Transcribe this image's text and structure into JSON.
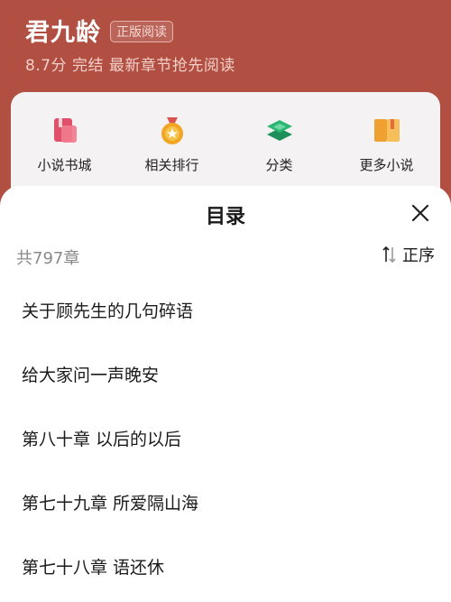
{
  "book": {
    "title": "君九龄",
    "badge": "正版阅读",
    "subtitle": "8.7分 完结 最新章节抢先阅读"
  },
  "menu": {
    "items": [
      {
        "label": "小说书城",
        "icon": "book-store-icon",
        "color": "#e0506a"
      },
      {
        "label": "相关排行",
        "icon": "medal-icon",
        "color": "#f0a623"
      },
      {
        "label": "分类",
        "icon": "layers-icon",
        "color": "#2bb673"
      },
      {
        "label": "更多小说",
        "icon": "open-book-icon",
        "color": "#f0a030"
      }
    ]
  },
  "toc": {
    "title": "目录",
    "count": "共797章",
    "order_label": "正序",
    "chapters": [
      "关于顾先生的几句碎语",
      "给大家问一声晚安",
      "第八十章 以后的以后",
      "第七十九章 所爱隔山海",
      "第七十八章 语还休"
    ]
  },
  "colors": {
    "header_bg": "#b24f43",
    "sheet_bg": "#ffffff",
    "muted_text": "#8a8a8a"
  }
}
